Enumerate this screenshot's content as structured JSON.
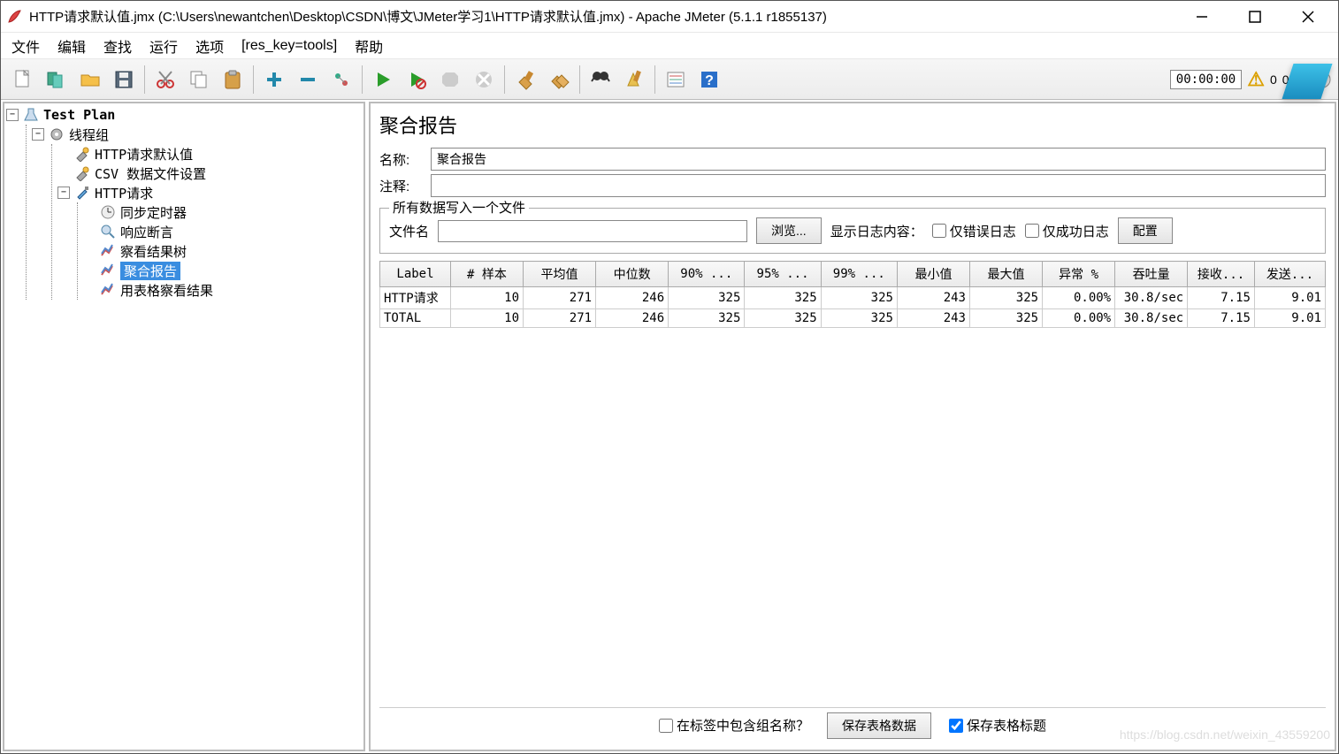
{
  "window": {
    "title": "HTTP请求默认值.jmx (C:\\Users\\newantchen\\Desktop\\CSDN\\博文\\JMeter学习1\\HTTP请求默认值.jmx) - Apache JMeter (5.1.1 r1855137)"
  },
  "menu": {
    "file": "文件",
    "edit": "编辑",
    "search": "查找",
    "run": "运行",
    "options": "选项",
    "tools": "[res_key=tools]",
    "help": "帮助"
  },
  "toolbar": {
    "time": "00:00:00",
    "warn_count": "0",
    "threads": "0/10"
  },
  "tree": {
    "root": "Test Plan",
    "thread_group": "线程组",
    "http_defaults": "HTTP请求默认值",
    "csv_config": "CSV 数据文件设置",
    "http_request": "HTTP请求",
    "sync_timer": "同步定时器",
    "resp_assert": "响应断言",
    "view_tree": "察看结果树",
    "aggregate": "聚合报告",
    "table_results": "用表格察看结果"
  },
  "panel": {
    "title": "聚合报告",
    "name_label": "名称:",
    "name_value": "聚合报告",
    "comment_label": "注释:",
    "comment_value": "",
    "file_legend": "所有数据写入一个文件",
    "file_label": "文件名",
    "file_value": "",
    "browse": "浏览...",
    "log_label": "显示日志内容：",
    "only_errors": "仅错误日志",
    "only_success": "仅成功日志",
    "configure": "配置"
  },
  "table": {
    "headers": [
      "Label",
      "# 样本",
      "平均值",
      "中位数",
      "90% ...",
      "95% ...",
      "99% ...",
      "最小值",
      "最大值",
      "异常 %",
      "吞吐量",
      "接收...",
      "发送..."
    ],
    "rows": [
      [
        "HTTP请求",
        "10",
        "271",
        "246",
        "325",
        "325",
        "325",
        "243",
        "325",
        "0.00%",
        "30.8/sec",
        "7.15",
        "9.01"
      ],
      [
        "TOTAL",
        "10",
        "271",
        "246",
        "325",
        "325",
        "325",
        "243",
        "325",
        "0.00%",
        "30.8/sec",
        "7.15",
        "9.01"
      ]
    ]
  },
  "bottom": {
    "include_group": "在标签中包含组名称？",
    "save_data": "保存表格数据",
    "save_header": "保存表格标题"
  },
  "watermark": "https://blog.csdn.net/weixin_43559200"
}
